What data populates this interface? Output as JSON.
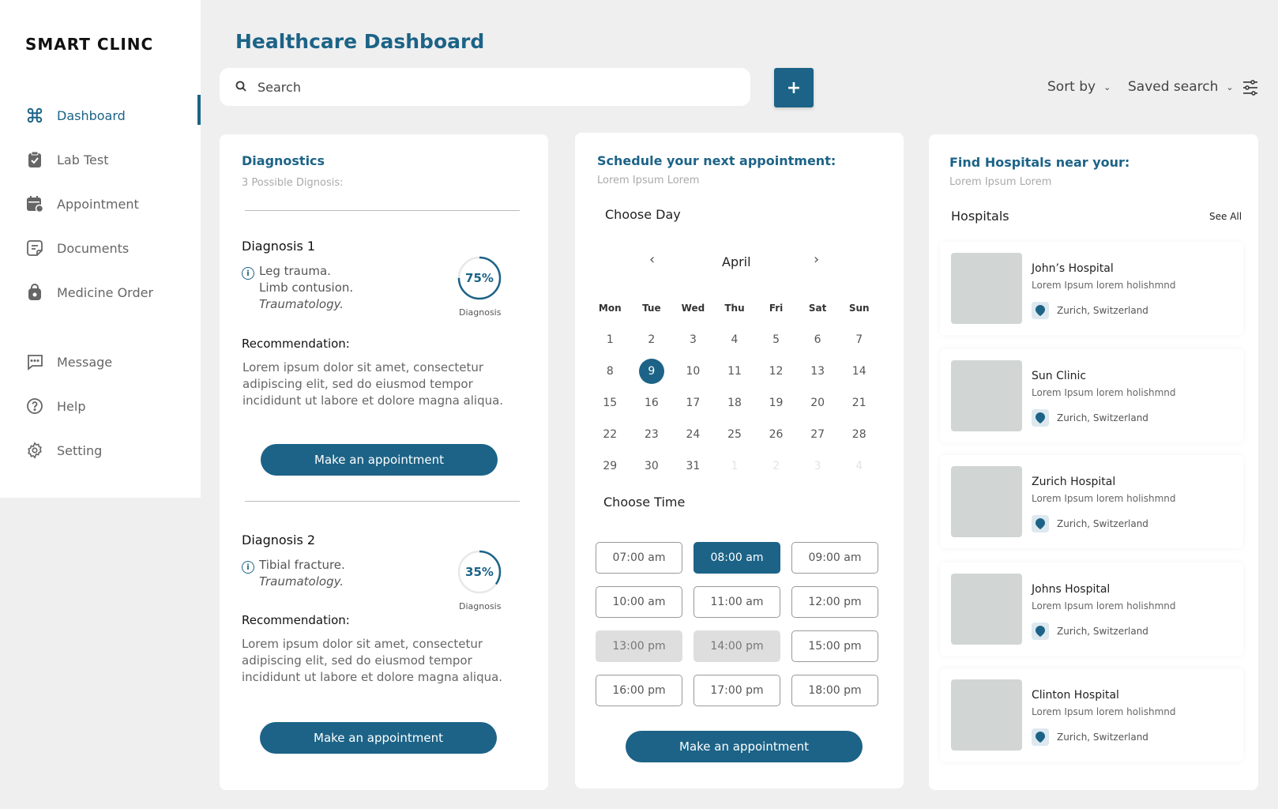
{
  "app": {
    "logo": "SMART CLINC",
    "title": "Healthcare Dashboard"
  },
  "sidebar": {
    "items": [
      {
        "label": "Dashboard",
        "icon": "command-icon",
        "active": true
      },
      {
        "label": "Lab Test",
        "icon": "clipboard-icon"
      },
      {
        "label": "Appointment",
        "icon": "calendar-icon"
      },
      {
        "label": "Documents",
        "icon": "document-icon"
      },
      {
        "label": "Medicine Order",
        "icon": "bag-icon"
      }
    ],
    "items2": [
      {
        "label": "Message",
        "icon": "message-icon"
      },
      {
        "label": "Help",
        "icon": "help-icon"
      },
      {
        "label": "Setting",
        "icon": "gear-icon"
      }
    ]
  },
  "header": {
    "search_placeholder": "Search",
    "add_label": "+",
    "sort_label": "Sort by",
    "saved_label": "Saved search"
  },
  "diagnostics": {
    "title": "Diagnostics",
    "subtitle": "3 Possible Dignosis:",
    "items": [
      {
        "name": "Diagnosis 1",
        "line1": "Leg trauma.",
        "line2": "Limb contusion.",
        "category": "Traumatology.",
        "percent": "75%",
        "progress": 0.75,
        "ring_label": "Diagnosis",
        "rec_head": "Recommendation:",
        "rec_text": "Lorem ipsum dolor sit amet, consectetur adipiscing elit, sed do eiusmod tempor incididunt ut labore et dolore magna aliqua.",
        "button": "Make an appointment"
      },
      {
        "name": "Diagnosis 2",
        "line1": "Tibial fracture.",
        "category": "Traumatology.",
        "percent": "35%",
        "progress": 0.35,
        "ring_label": "Diagnosis",
        "rec_head": "Recommendation:",
        "rec_text": "Lorem ipsum dolor sit amet, consectetur adipiscing elit, sed do eiusmod tempor incididunt ut labore et dolore magna aliqua.",
        "button": "Make an appointment"
      }
    ]
  },
  "schedule": {
    "title": "Schedule your next appointment:",
    "subtitle": "Lorem Ipsum Lorem",
    "choose_day": "Choose Day",
    "month": "April",
    "weekdays": [
      "Mon",
      "Tue",
      "Wed",
      "Thu",
      "Fri",
      "Sat",
      "Sun"
    ],
    "days": [
      "1",
      "2",
      "3",
      "4",
      "5",
      "6",
      "7",
      "8",
      "9",
      "10",
      "11",
      "12",
      "13",
      "14",
      "15",
      "16",
      "17",
      "18",
      "19",
      "20",
      "21",
      "22",
      "23",
      "24",
      "25",
      "26",
      "27",
      "28",
      "29",
      "30",
      "31",
      "1",
      "2",
      "3",
      "4"
    ],
    "selected_day": "9",
    "choose_time": "Choose Time",
    "times": [
      {
        "label": "07:00 am",
        "state": ""
      },
      {
        "label": "08:00 am",
        "state": "sel"
      },
      {
        "label": "09:00 am",
        "state": ""
      },
      {
        "label": "10:00 am",
        "state": ""
      },
      {
        "label": "11:00 am",
        "state": ""
      },
      {
        "label": "12:00 pm",
        "state": ""
      },
      {
        "label": "13:00 pm",
        "state": "off"
      },
      {
        "label": "14:00 pm",
        "state": "off"
      },
      {
        "label": "15:00 pm",
        "state": ""
      },
      {
        "label": "16:00 pm",
        "state": ""
      },
      {
        "label": "17:00 pm",
        "state": ""
      },
      {
        "label": "18:00 pm",
        "state": ""
      }
    ],
    "button": "Make an appointment"
  },
  "hospitals": {
    "title": "Find Hospitals near your:",
    "subtitle": "Lorem Ipsum Lorem",
    "list_title": "Hospitals",
    "see_all": "See All",
    "items": [
      {
        "name": "John’s Hospital",
        "desc": "Lorem Ipsum lorem holishmnd",
        "location": "Zurich, Switzerland"
      },
      {
        "name": "Sun Clinic",
        "desc": "Lorem Ipsum lorem holishmnd",
        "location": "Zurich, Switzerland"
      },
      {
        "name": "Zurich Hospital",
        "desc": "Lorem Ipsum lorem holishmnd",
        "location": "Zurich, Switzerland"
      },
      {
        "name": "Johns Hospital",
        "desc": "Lorem Ipsum lorem holishmnd",
        "location": "Zurich, Switzerland"
      },
      {
        "name": "Clinton Hospital",
        "desc": "Lorem Ipsum lorem holishmnd",
        "location": "Zurich, Switzerland"
      }
    ]
  },
  "colors": {
    "accent": "#1c6387",
    "background": "#efefef",
    "thumb": "#d1d6d5"
  }
}
